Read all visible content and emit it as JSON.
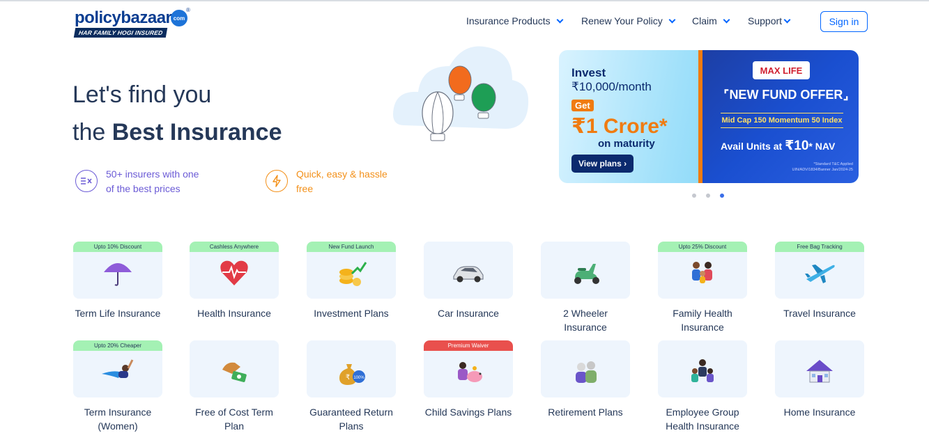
{
  "header": {
    "logo": {
      "word": "policybazaar",
      "dotcom": "com",
      "reg": "®",
      "tagline": "HAR FAMILY HOGI INSURED"
    },
    "nav": [
      {
        "label": "Insurance Products"
      },
      {
        "label": "Renew Your Policy"
      },
      {
        "label": "Claim"
      },
      {
        "label": "Support"
      }
    ],
    "signin_label": "Sign in"
  },
  "hero": {
    "line1": "Let's find you",
    "line2_prefix": "the ",
    "line2_bold": "Best Insurance",
    "features": [
      {
        "icon": "compare-icon",
        "text": "50+ insurers with one of the best prices",
        "color": "#6b5bd6"
      },
      {
        "icon": "lightning-icon",
        "text": "Quick, easy & hassle free",
        "color": "#f39019"
      }
    ]
  },
  "banner": {
    "invest": "Invest",
    "amount": "₹10,000/month",
    "get": "Get",
    "crore": "₹1 Crore*",
    "maturity": "on maturity",
    "cta": "View plans ›",
    "brand": "MAX LIFE",
    "offer": "⌜NEW FUND OFFER⌟",
    "fund": "Mid Cap 150 Momentum 50 Index",
    "avail_prefix": "Avail Units at ",
    "avail_value": "₹10",
    "avail_suffix": "* NAV",
    "fine1": "*Standard T&C Applied",
    "fine2": "UIN/ADV/1834/Banner Jan/2024-25"
  },
  "carousel": {
    "count": 3,
    "active_index": 2
  },
  "products": [
    {
      "label": "Term Life Insurance",
      "badge": "Upto 10% Discount",
      "icon": "umbrella-icon"
    },
    {
      "label": "Health Insurance",
      "badge": "Cashless Anywhere",
      "icon": "heart-pulse-icon"
    },
    {
      "label": "Investment Plans",
      "badge": "New Fund Launch",
      "icon": "coins-growth-icon"
    },
    {
      "label": "Car Insurance",
      "badge": "",
      "icon": "car-icon"
    },
    {
      "label": "2 Wheeler Insurance",
      "badge": "",
      "icon": "scooter-icon"
    },
    {
      "label": "Family Health Insurance",
      "badge": "Upto 25% Discount",
      "icon": "family-icon"
    },
    {
      "label": "Travel Insurance",
      "badge": "Free Bag Tracking",
      "icon": "airplane-icon"
    },
    {
      "label": "Term Insurance (Women)",
      "badge": "Upto 20% Cheaper",
      "icon": "superwoman-icon"
    },
    {
      "label": "Free of Cost Term Plan",
      "badge": "",
      "icon": "hand-money-icon"
    },
    {
      "label": "Guaranteed Return Plans",
      "badge": "",
      "icon": "money-bag-icon"
    },
    {
      "label": "Child Savings Plans",
      "badge": "Premium Waiver",
      "badge_color": "#e9504d",
      "icon": "piggy-bank-icon"
    },
    {
      "label": "Retirement Plans",
      "badge": "",
      "icon": "elderly-couple-icon"
    },
    {
      "label": "Employee Group Health Insurance",
      "badge": "",
      "icon": "employee-group-icon"
    },
    {
      "label": "Home Insurance",
      "badge": "",
      "icon": "house-icon"
    }
  ],
  "colors": {
    "brand_blue": "#0065ff",
    "text": "#253858",
    "card_bg": "#eef5fd",
    "badge_green": "#a4f1b4",
    "accent_orange": "#f07b10"
  }
}
